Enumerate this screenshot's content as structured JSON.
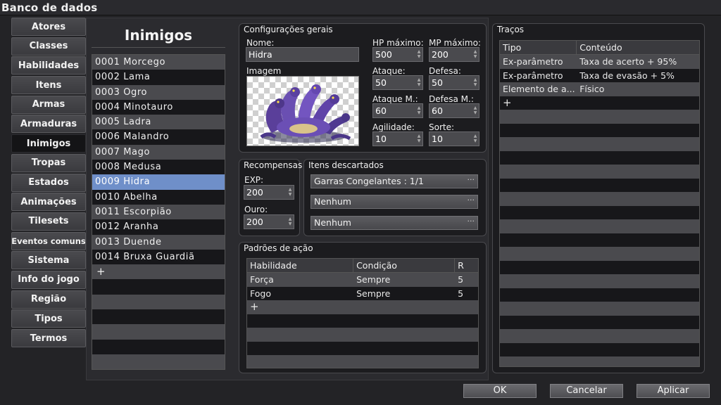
{
  "window": {
    "title": "Banco de dados"
  },
  "categories": [
    {
      "label": "Atores"
    },
    {
      "label": "Classes"
    },
    {
      "label": "Habilidades"
    },
    {
      "label": "Itens"
    },
    {
      "label": "Armas"
    },
    {
      "label": "Armaduras"
    },
    {
      "label": "Inimigos",
      "active": true
    },
    {
      "label": "Tropas"
    },
    {
      "label": "Estados"
    },
    {
      "label": "Animações"
    },
    {
      "label": "Tilesets"
    },
    {
      "label": "Eventos comuns"
    },
    {
      "label": "Sistema"
    },
    {
      "label": "Info do jogo"
    },
    {
      "label": "Região"
    },
    {
      "label": "Tipos"
    },
    {
      "label": "Termos"
    }
  ],
  "enemy_list": {
    "title": "Inimigos",
    "items": [
      "0001 Morcego",
      "0002 Lama",
      "0003 Ogro",
      "0004 Minotauro",
      "0005 Ladra",
      "0006 Malandro",
      "0007 Mago",
      "0008 Medusa",
      "0009 Hidra",
      "0010 Abelha",
      "0011 Escorpião",
      "0012 Aranha",
      "0013 Duende",
      "0014 Bruxa Guardiã"
    ],
    "selected_index": 8,
    "add_label": "+"
  },
  "general": {
    "title": "Configurações gerais",
    "name_label": "Nome:",
    "name_value": "Hidra",
    "image_label": "Imagem",
    "hp_label": "HP máximo:",
    "hp_value": "500",
    "mp_label": "MP máximo:",
    "mp_value": "200",
    "atk_label": "Ataque:",
    "atk_value": "50",
    "def_label": "Defesa:",
    "def_value": "50",
    "matk_label": "Ataque M.:",
    "matk_value": "60",
    "mdef_label": "Defesa M.:",
    "mdef_value": "60",
    "agi_label": "Agilidade:",
    "agi_value": "10",
    "luk_label": "Sorte:",
    "luk_value": "10"
  },
  "rewards": {
    "title": "Recompensas",
    "exp_label": "EXP:",
    "exp_value": "200",
    "gold_label": "Ouro:",
    "gold_value": "200"
  },
  "drops": {
    "title": "Itens descartados",
    "items": [
      "Garras Congelantes : 1/1",
      "Nenhum",
      "Nenhum"
    ],
    "dots": "···"
  },
  "actions": {
    "title": "Padrões de ação",
    "headers": [
      "Habilidade",
      "Condição",
      "R"
    ],
    "rows": [
      [
        "Força",
        "Sempre",
        "5"
      ],
      [
        "Fogo",
        "Sempre",
        "5"
      ]
    ],
    "add_label": "+"
  },
  "traits": {
    "title": "Traços",
    "headers": [
      "Tipo",
      "Conteúdo"
    ],
    "rows": [
      [
        "Ex-parâmetro",
        "Taxa de acerto + 95%"
      ],
      [
        "Ex-parâmetro",
        "Taxa de evasão + 5%"
      ],
      [
        "Elemento de a...",
        "Físico"
      ]
    ],
    "add_label": "+"
  },
  "buttons": {
    "ok": "OK",
    "cancel": "Cancelar",
    "apply": "Aplicar"
  }
}
